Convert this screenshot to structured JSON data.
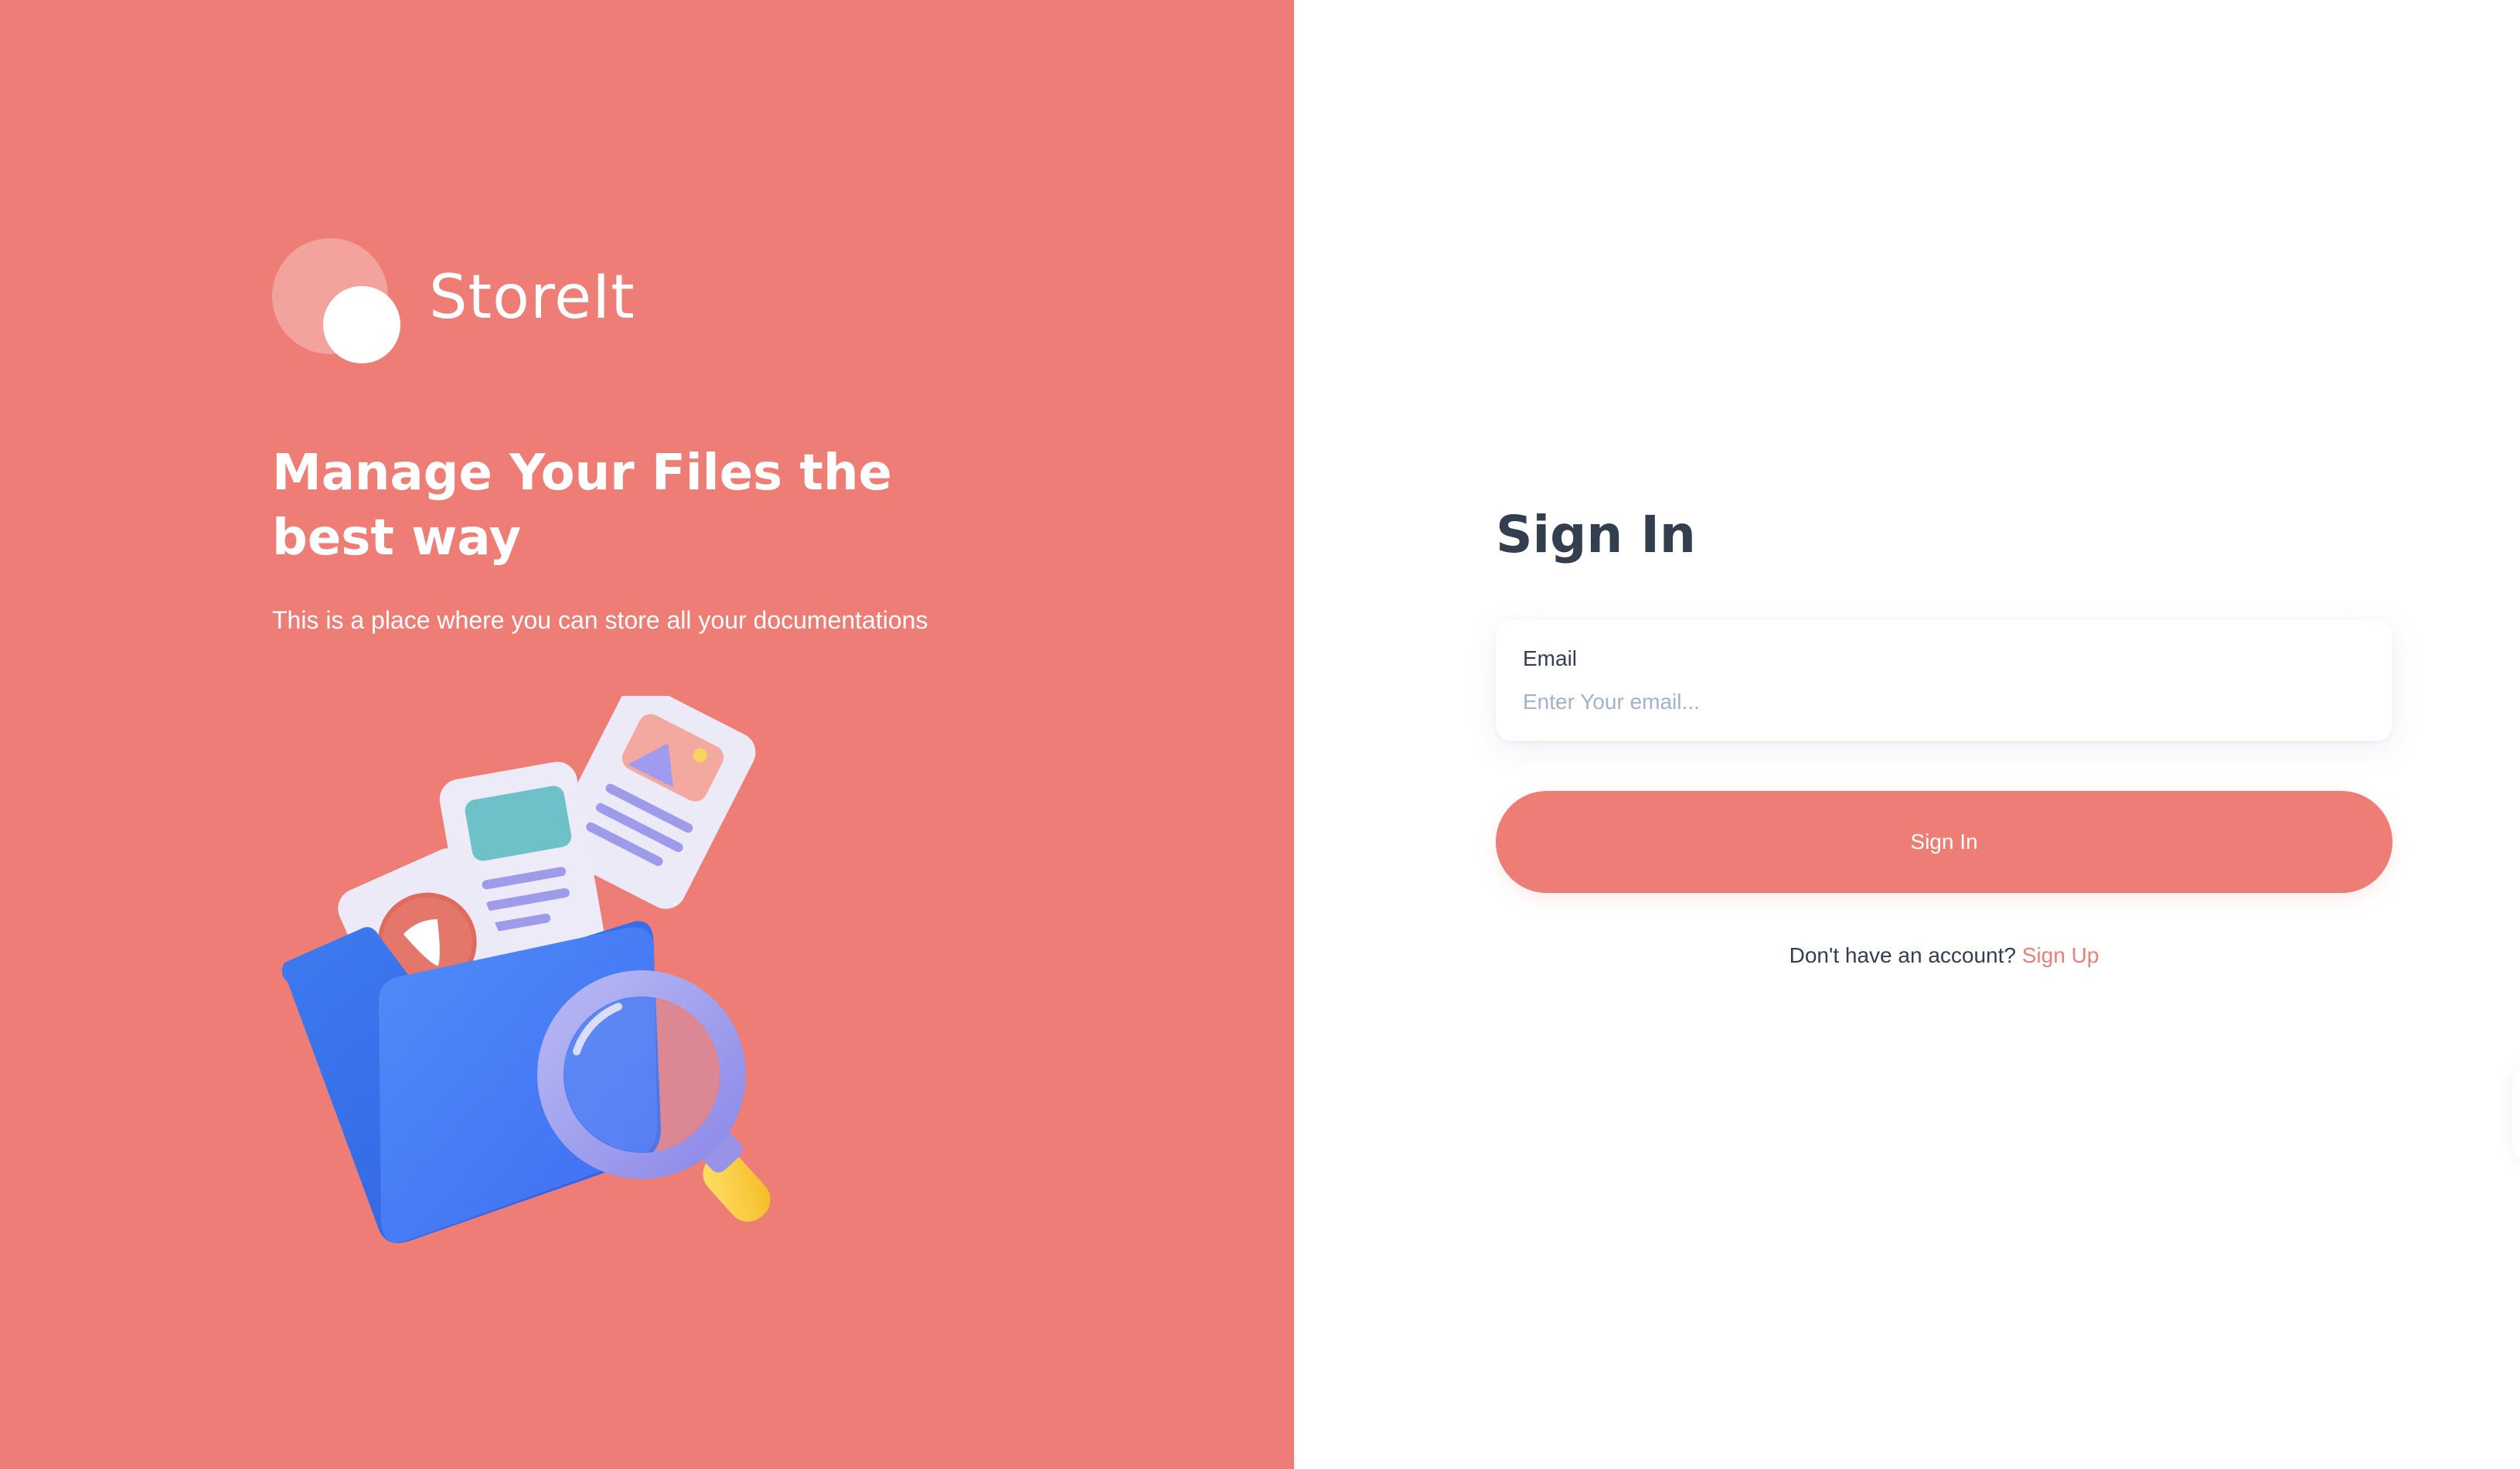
{
  "brand": {
    "name": "StoreIt",
    "colors": {
      "primary": "#EE7D75",
      "logo_back": "#F3A39E",
      "text_dark": "#333F4E",
      "placeholder": "#A3B2C7"
    }
  },
  "hero": {
    "title": "Manage Your Files the best way",
    "subtitle": "This is a place where you can store all your documentations",
    "illustration_icon": "files-folder-search-illustration"
  },
  "form": {
    "title": "Sign In",
    "email_label": "Email",
    "email_value": "",
    "email_placeholder": "Enter Your email...",
    "submit_label": "Sign In",
    "no_account_text": "Don't have an account?",
    "signup_label": "Sign Up"
  }
}
